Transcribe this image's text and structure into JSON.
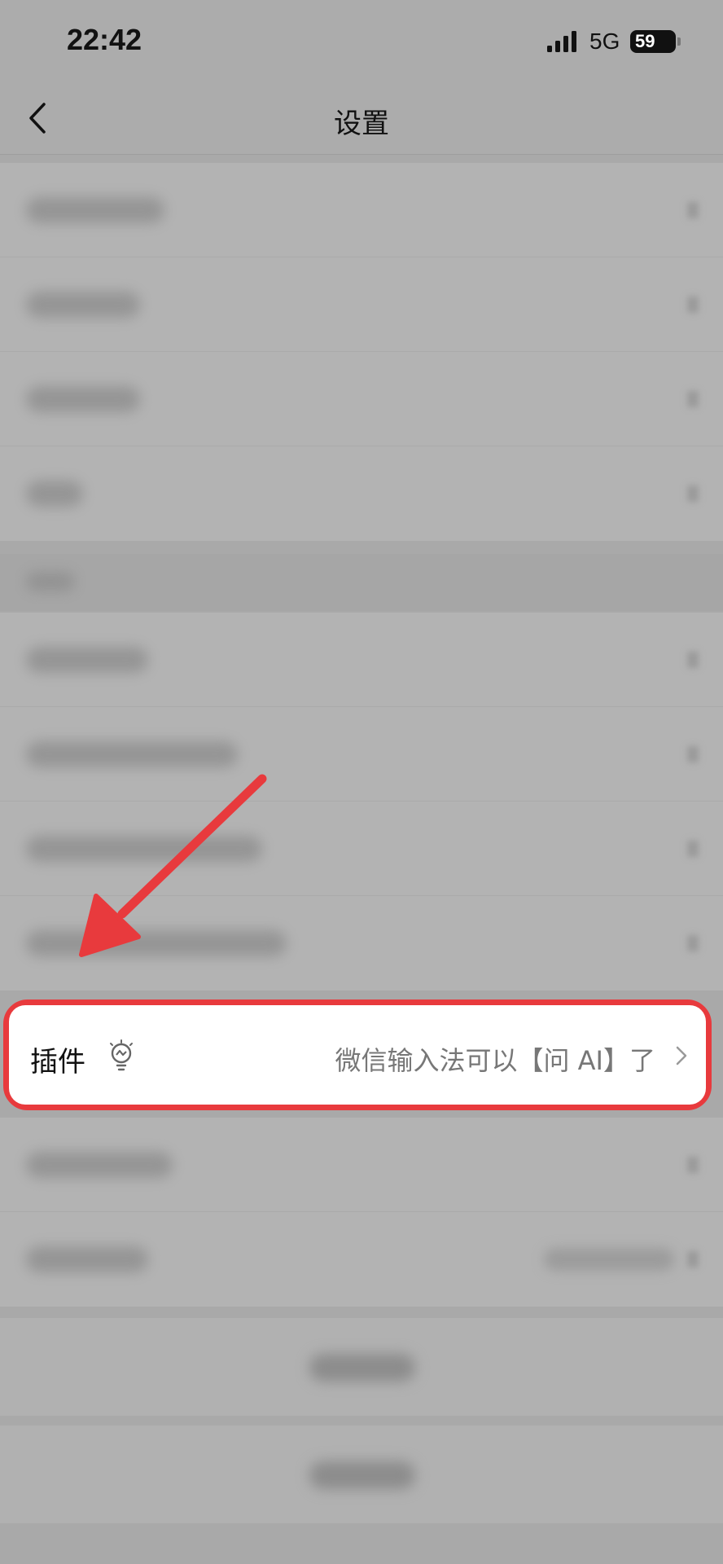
{
  "status_bar": {
    "time": "22:42",
    "network": "5G",
    "battery": "59"
  },
  "header": {
    "title": "设置",
    "back_icon": "chevron-left-icon"
  },
  "plugin_item": {
    "label": "插件",
    "icon": "lightbulb-icon",
    "description": "微信输入法可以【问 AI】了",
    "chevron_icon": "chevron-right-icon"
  },
  "annotation": {
    "highlight_color": "#e83a3d"
  },
  "colors": {
    "overlay": "#a9a9a9",
    "plugin_row_bg": "#ffffff"
  }
}
